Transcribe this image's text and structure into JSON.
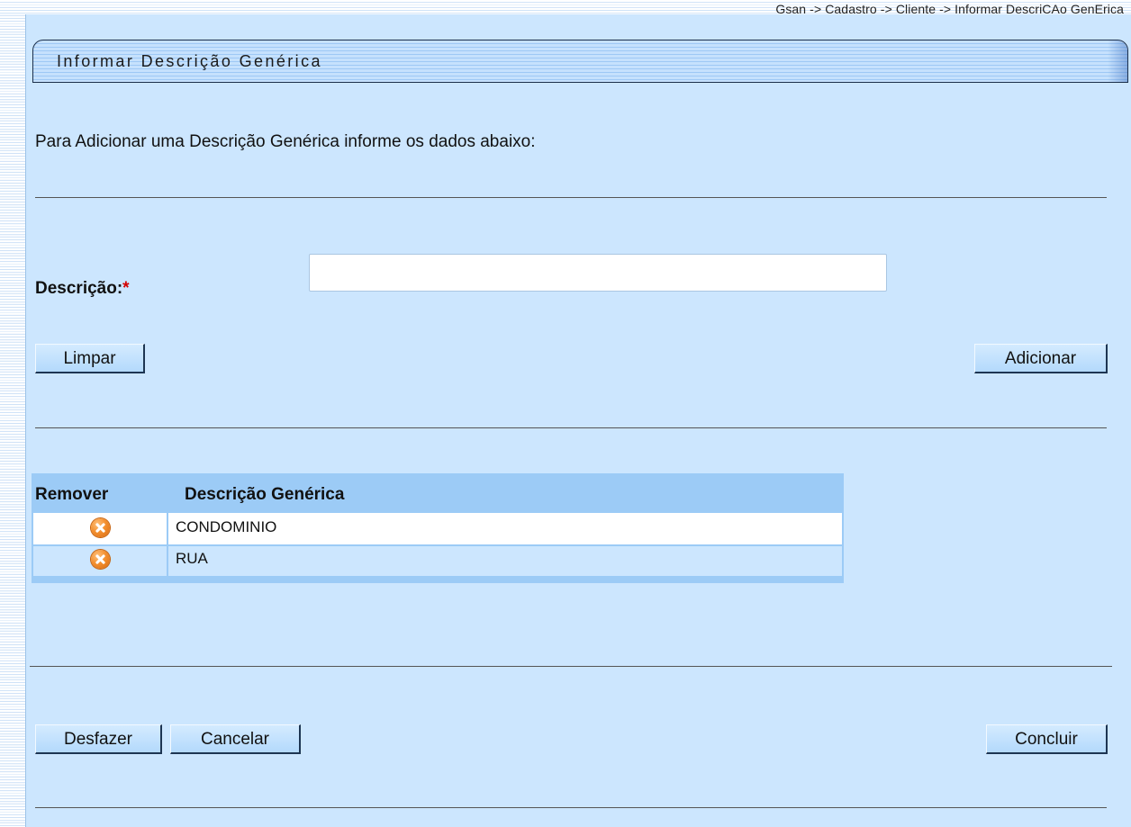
{
  "breadcrumb": "Gsan -> Cadastro -> Cliente -> Informar DescriCAo GenErica",
  "page_title": "Informar Descrição Genérica",
  "instruction": "Para Adicionar uma Descrição Genérica informe os dados abaixo:",
  "form": {
    "description_label": "Descrição:",
    "required_marker": "*",
    "description_value": ""
  },
  "buttons": {
    "clear": "Limpar",
    "add": "Adicionar",
    "undo": "Desfazer",
    "cancel": "Cancelar",
    "finish": "Concluir"
  },
  "table": {
    "columns": [
      "Remover",
      "Descrição Genérica"
    ],
    "rows": [
      {
        "remove_icon": "remove-circle-x-icon",
        "description": "CONDOMINIO"
      },
      {
        "remove_icon": "remove-circle-x-icon",
        "description": "RUA"
      }
    ]
  },
  "colors": {
    "panel_background": "#cce6fe",
    "table_header": "#9ccbf6",
    "remove_icon": "#f39030",
    "required_marker": "#d40000"
  }
}
